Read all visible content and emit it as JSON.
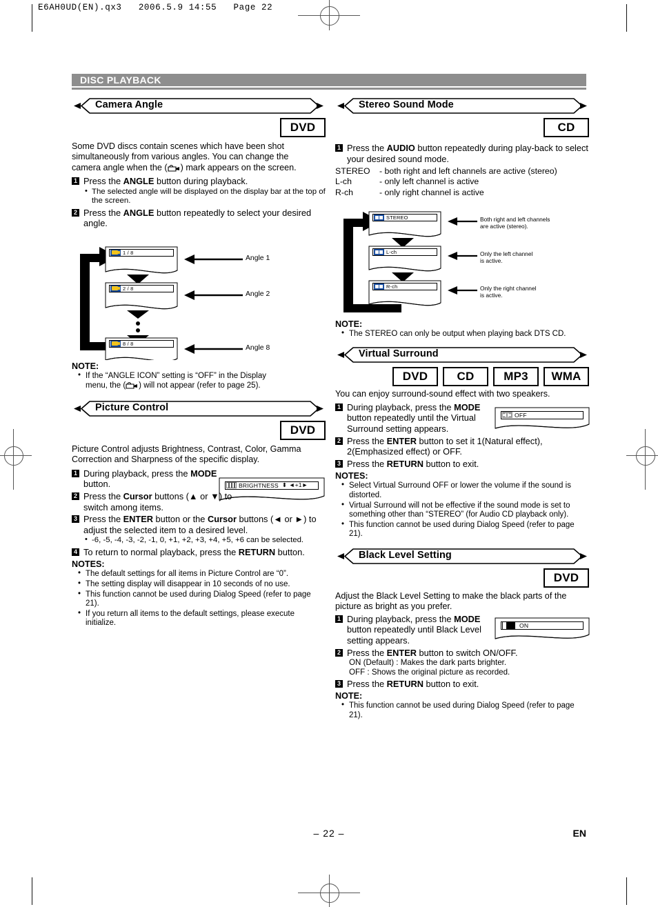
{
  "file_header": "E6AH0UD(EN).qx3   2006.5.9 14:55   Page 22",
  "chapter": "DISC PLAYBACK",
  "footer": {
    "page_number": "– 22 –",
    "language": "EN"
  },
  "colors": {
    "band": "#8e8e8e",
    "osd_blue": "#1b4fa0",
    "osd_yellow": "#f2c31b"
  },
  "camera_angle": {
    "title": "Camera Angle",
    "badges": [
      "DVD"
    ],
    "intro": "Some DVD discs contain scenes which have been shot simultaneously from various angles. You can change the camera angle when the (  ) mark appears on the screen.",
    "intro_a": "Some DVD discs contain scenes which have been shot",
    "intro_b": "simultaneously from various angles. You can change the",
    "intro_c1": "camera angle when the (",
    "intro_c2": ") mark appears on the screen.",
    "step1_pre": "Press the ",
    "step1_b": "ANGLE",
    "step1_post": " button during playback.",
    "step1_sub": "The selected angle will be displayed on the display bar at the top of the screen.",
    "step2_pre": "Press the ",
    "step2_b": "ANGLE",
    "step2_post": " button repeatedly to select your desired angle.",
    "screens": [
      {
        "osd": "1 / 8",
        "label": "Angle 1"
      },
      {
        "osd": "2 / 8",
        "label": "Angle 2"
      },
      {
        "osd": "8 / 8",
        "label": "Angle 8"
      }
    ],
    "note_head": "NOTE:",
    "note_a": "If the “ANGLE ICON” setting is “OFF” in the Display",
    "note_b1": "menu, the (",
    "note_b2": ") will not appear (refer to page 25)."
  },
  "picture_control": {
    "title": "Picture Control",
    "badges": [
      "DVD"
    ],
    "intro_a": "Picture Control adjusts Brightness, Contrast, Color, Gamma",
    "intro_b": "Correction and Sharpness of the specific display.",
    "step1_pre": "During playback, press the ",
    "step1_b": "MODE",
    "step1_post": " button.",
    "step2_pre": "Press the ",
    "step2_b": "Cursor",
    "step2_post": " buttons (▲ or ▼) to switch among items.",
    "step3_pre": "Press the ",
    "step3_b1": "ENTER",
    "step3_mid": " button or the ",
    "step3_b2": "Cursor",
    "step3_post": " buttons (◄ or ►) to adjust the selected item to a desired level.",
    "step3_sub": "-6, -5, -4, -3, -2, -1, 0, +1, +2, +3, +4, +5, +6 can be selected.",
    "step4_pre": "To return to normal playback, press the ",
    "step4_b": "RETURN",
    "step4_post": " button.",
    "osd_label": "BRIGHTNESS",
    "osd_value": "⬍  ◄+1►",
    "notes_head": "NOTES:",
    "notes": [
      "The default settings for all items in Picture Control are “0”.",
      "The setting display will disappear in 10 seconds of no use.",
      "This function cannot be used during Dialog Speed (refer to page 21).",
      "If you return all items to the default settings, please execute initialize."
    ]
  },
  "stereo_sound_mode": {
    "title": "Stereo Sound Mode",
    "badges": [
      "CD"
    ],
    "step1_pre": "Press the ",
    "step1_b": "AUDIO",
    "step1_post": " button repeatedly during play-back to select your desired sound mode.",
    "definitions": [
      {
        "term": "STEREO",
        "desc": "- both right and left channels are active (stereo)"
      },
      {
        "term": "L-ch",
        "desc": "- only left channel is active"
      },
      {
        "term": "R-ch",
        "desc": "- only right channel is active"
      }
    ],
    "screens": [
      {
        "osd": "STEREO",
        "callout_a": "Both right and left channels",
        "callout_b": "are active (stereo)."
      },
      {
        "osd": "L-ch",
        "callout_a": "Only the left channel",
        "callout_b": "is active."
      },
      {
        "osd": "R-ch",
        "callout_a": "Only the right channel",
        "callout_b": "is active."
      }
    ],
    "note_head": "NOTE:",
    "note": "The STEREO can only be output when playing back DTS CD."
  },
  "virtual_surround": {
    "title": "Virtual Surround",
    "badges": [
      "DVD",
      "CD",
      "MP3",
      "WMA"
    ],
    "intro": "You can enjoy surround-sound effect with two speakers.",
    "step1_pre": "During playback, press the ",
    "step1_b": "MODE",
    "step1_post": " button repeatedly until the Virtual Surround setting appears.",
    "osd_value": "OFF",
    "step2_pre": "Press the ",
    "step2_b": "ENTER",
    "step2_post": " button to set it 1(Natural effect), 2(Emphasized effect) or OFF.",
    "step3_pre": "Press the ",
    "step3_b": "RETURN",
    "step3_post": " button to exit.",
    "notes_head": "NOTES:",
    "notes": [
      "Select Virtual Surround OFF or lower the volume if the sound is distorted.",
      "Virtual Surround will not be effective if the sound mode is set to something other than “STEREO” (for Audio CD playback only).",
      "This function cannot be used during Dialog Speed (refer to page 21)."
    ]
  },
  "black_level_setting": {
    "title": "Black Level Setting",
    "badges": [
      "DVD"
    ],
    "intro_a": "Adjust the Black Level Setting to make the black parts of the",
    "intro_b": "picture as bright as you prefer.",
    "step1_pre": "During playback, press the ",
    "step1_b": "MODE",
    "step1_post": " button repeatedly until Black Level setting appears.",
    "osd_value": "ON",
    "step2_pre": "Press the ",
    "step2_b": "ENTER",
    "step2_post": " button to switch ON/OFF.",
    "step2_sub_a": "ON (Default) : Makes the dark parts brighter.",
    "step2_sub_b": "OFF : Shows the original picture as recorded.",
    "step3_pre": "Press the ",
    "step3_b": "RETURN",
    "step3_post": " button to exit.",
    "note_head": "NOTE:",
    "note": "This function cannot be used during Dialog Speed (refer to page 21)."
  }
}
